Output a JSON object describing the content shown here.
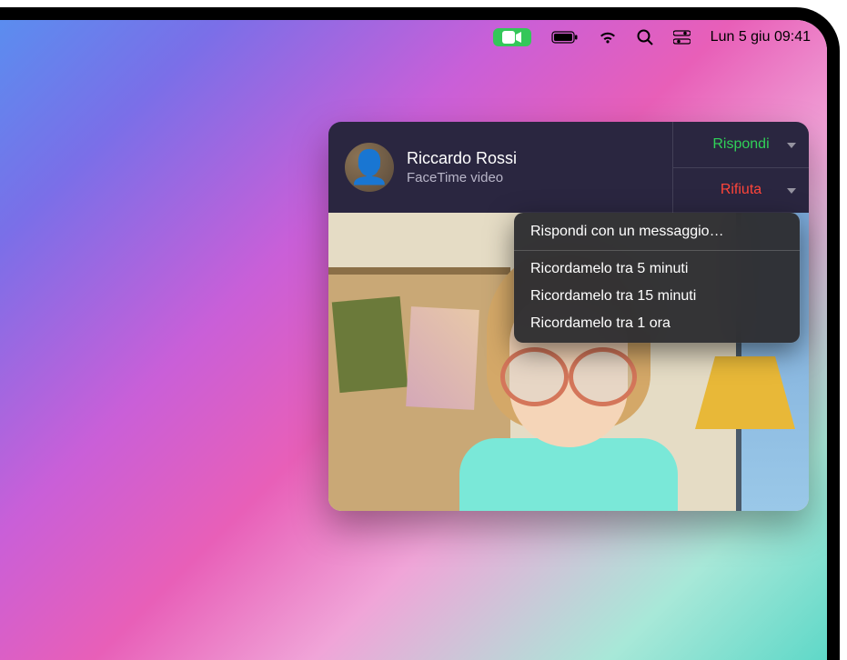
{
  "menubar": {
    "datetime": "Lun 5 giu  09:41"
  },
  "notification": {
    "caller_name": "Riccardo Rossi",
    "call_type": "FaceTime video",
    "accept_label": "Rispondi",
    "decline_label": "Rifiuta"
  },
  "dropdown": {
    "reply_message": "Rispondi con un messaggio…",
    "remind_5": "Ricordamelo tra 5 minuti",
    "remind_15": "Ricordamelo tra 15 minuti",
    "remind_1h": "Ricordamelo tra 1 ora"
  }
}
